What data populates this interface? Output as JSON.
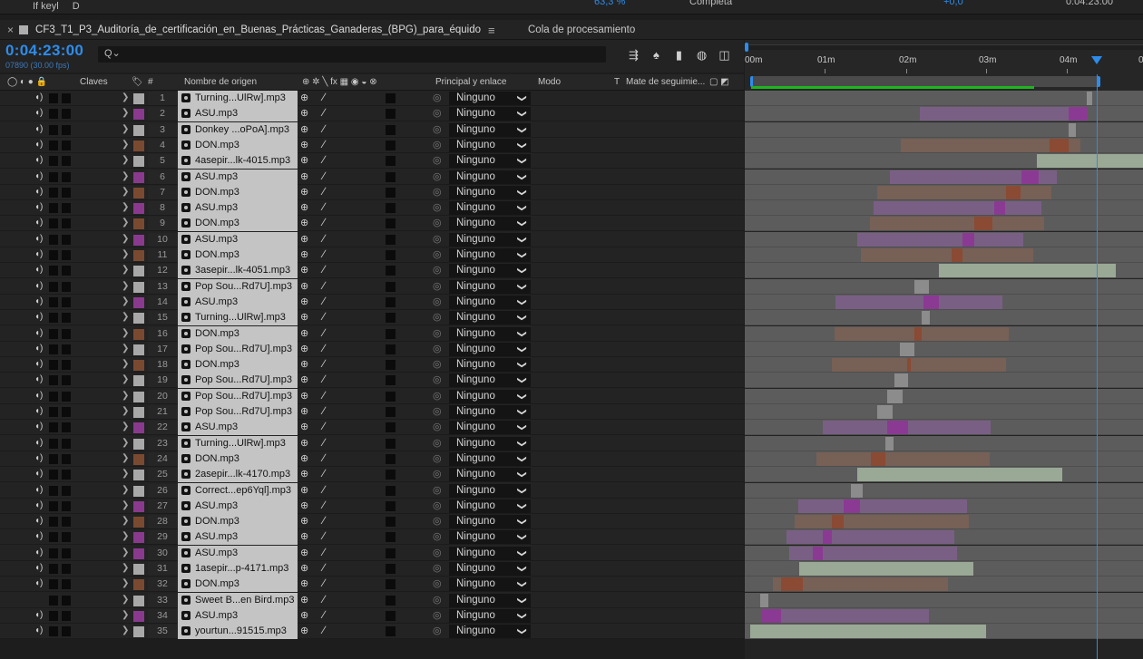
{
  "top_strip": {
    "items": [
      "If keyl",
      "D"
    ],
    "zoom": "63,3 %",
    "resolution": "Completa",
    "exposure": "+0,0",
    "timecode": "0:04:23:00"
  },
  "tabs": [
    {
      "label": "CF3_T1_P3_Auditoría_de_certificación_en_Buenas_Prácticas_Ganaderas_(BPG)_para_équido",
      "active": true
    },
    {
      "label": "Cola de procesamiento",
      "active": false
    }
  ],
  "timecode": {
    "current": "0:04:23:00",
    "frames": "07890 (30.00 fps)"
  },
  "search": {
    "placeholder": "",
    "value": "",
    "icon": "search-icon"
  },
  "columns": {
    "claves": "Claves",
    "hash": "#",
    "source": "Nombre de origen",
    "parent": "Principal y enlace",
    "mode": "Modo",
    "t": "T",
    "trackmatte": "Mate de seguimie..."
  },
  "ruler": {
    "labels": [
      "00m",
      "01m",
      "02m",
      "03m",
      "04m",
      "0"
    ]
  },
  "label_colors": {
    "gray": "#a8a8a8",
    "purple": "#8a3a8e",
    "brown": "#7a4a30"
  },
  "layers": [
    {
      "num": "1",
      "name": "Turning...UlRw].mp3",
      "color": "#a8a8a8",
      "parent": "Ninguno",
      "bar": {
        "kind": "gray",
        "start": 377,
        "end": 383,
        "kstart": 377,
        "kend": 383
      }
    },
    {
      "num": "2",
      "name": "ASU.mp3",
      "color": "#8a3a8e",
      "parent": "Ninguno",
      "bar": {
        "kind": "purple",
        "start": 193,
        "end": 378,
        "kstart": 357,
        "kend": 378
      }
    },
    {
      "num": "3",
      "name": "Donkey ...oPoA].mp3",
      "color": "#a8a8a8",
      "parent": "Ninguno",
      "bar": {
        "kind": "gray",
        "start": 357,
        "end": 365,
        "kstart": 357,
        "kend": 365
      }
    },
    {
      "num": "4",
      "name": "DON.mp3",
      "color": "#7a4a30",
      "parent": "Ninguno",
      "bar": {
        "kind": "brown",
        "start": 172,
        "end": 370,
        "kstart": 336,
        "kend": 357
      }
    },
    {
      "num": "5",
      "name": "4asepir...lk-4015.mp3",
      "color": "#a8a8a8",
      "parent": "Ninguno",
      "bar": {
        "kind": "green",
        "start": 322,
        "end": 439,
        "kstart": 322,
        "kend": 439
      }
    },
    {
      "num": "6",
      "name": "ASU.mp3",
      "color": "#8a3a8e",
      "parent": "Ninguno",
      "bar": {
        "kind": "purple",
        "start": 160,
        "end": 344,
        "kstart": 305,
        "kend": 324
      }
    },
    {
      "num": "7",
      "name": "DON.mp3",
      "color": "#7a4a30",
      "parent": "Ninguno",
      "bar": {
        "kind": "brown",
        "start": 146,
        "end": 338,
        "kstart": 288,
        "kend": 304
      }
    },
    {
      "num": "8",
      "name": "ASU.mp3",
      "color": "#8a3a8e",
      "parent": "Ninguno",
      "bar": {
        "kind": "purple",
        "start": 142,
        "end": 327,
        "kstart": 275,
        "kend": 287
      }
    },
    {
      "num": "9",
      "name": "DON.mp3",
      "color": "#7a4a30",
      "parent": "Ninguno",
      "bar": {
        "kind": "brown",
        "start": 138,
        "end": 330,
        "kstart": 253,
        "kend": 273
      }
    },
    {
      "num": "10",
      "name": "ASU.mp3",
      "color": "#8a3a8e",
      "parent": "Ninguno",
      "bar": {
        "kind": "purple",
        "start": 124,
        "end": 307,
        "kstart": 240,
        "kend": 253
      }
    },
    {
      "num": "11",
      "name": "DON.mp3",
      "color": "#7a4a30",
      "parent": "Ninguno",
      "bar": {
        "kind": "brown",
        "start": 128,
        "end": 318,
        "kstart": 228,
        "kend": 240
      }
    },
    {
      "num": "12",
      "name": "3asepir...lk-4051.mp3",
      "color": "#a8a8a8",
      "parent": "Ninguno",
      "bar": {
        "kind": "green",
        "start": 214,
        "end": 409,
        "kstart": 214,
        "kend": 409
      }
    },
    {
      "num": "13",
      "name": "Pop Sou...Rd7U].mp3",
      "color": "#a8a8a8",
      "parent": "Ninguno",
      "bar": {
        "kind": "gray",
        "start": 187,
        "end": 203,
        "kstart": 187,
        "kend": 203
      }
    },
    {
      "num": "14",
      "name": "ASU.mp3",
      "color": "#8a3a8e",
      "parent": "Ninguno",
      "bar": {
        "kind": "purple",
        "start": 100,
        "end": 284,
        "kstart": 197,
        "kend": 214
      }
    },
    {
      "num": "15",
      "name": "Turning...UlRw].mp3",
      "color": "#a8a8a8",
      "parent": "Ninguno",
      "bar": {
        "kind": "gray",
        "start": 195,
        "end": 204,
        "kstart": 195,
        "kend": 204
      }
    },
    {
      "num": "16",
      "name": "DON.mp3",
      "color": "#7a4a30",
      "parent": "Ninguno",
      "bar": {
        "kind": "brown",
        "start": 99,
        "end": 291,
        "kstart": 187,
        "kend": 195
      }
    },
    {
      "num": "17",
      "name": "Pop Sou...Rd7U].mp3",
      "color": "#a8a8a8",
      "parent": "Ninguno",
      "bar": {
        "kind": "gray",
        "start": 171,
        "end": 187,
        "kstart": 171,
        "kend": 187
      }
    },
    {
      "num": "18",
      "name": "DON.mp3",
      "color": "#7a4a30",
      "parent": "Ninguno",
      "bar": {
        "kind": "brown",
        "start": 96,
        "end": 288,
        "kstart": 179,
        "kend": 183
      }
    },
    {
      "num": "19",
      "name": "Pop Sou...Rd7U].mp3",
      "color": "#a8a8a8",
      "parent": "Ninguno",
      "bar": {
        "kind": "gray",
        "start": 165,
        "end": 180,
        "kstart": 165,
        "kend": 180
      }
    },
    {
      "num": "20",
      "name": "Pop Sou...Rd7U].mp3",
      "color": "#a8a8a8",
      "parent": "Ninguno",
      "bar": {
        "kind": "gray",
        "start": 157,
        "end": 174,
        "kstart": 157,
        "kend": 174
      }
    },
    {
      "num": "21",
      "name": "Pop Sou...Rd7U].mp3",
      "color": "#a8a8a8",
      "parent": "Ninguno",
      "bar": {
        "kind": "gray",
        "start": 146,
        "end": 163,
        "kstart": 146,
        "kend": 163
      }
    },
    {
      "num": "22",
      "name": "ASU.mp3",
      "color": "#8a3a8e",
      "parent": "Ninguno",
      "bar": {
        "kind": "purple",
        "start": 86,
        "end": 271,
        "kstart": 157,
        "kend": 180
      }
    },
    {
      "num": "23",
      "name": "Turning...UlRw].mp3",
      "color": "#a8a8a8",
      "parent": "Ninguno",
      "bar": {
        "kind": "gray",
        "start": 155,
        "end": 164,
        "kstart": 155,
        "kend": 164
      }
    },
    {
      "num": "24",
      "name": "DON.mp3",
      "color": "#7a4a30",
      "parent": "Ninguno",
      "bar": {
        "kind": "brown",
        "start": 79,
        "end": 270,
        "kstart": 139,
        "kend": 155
      }
    },
    {
      "num": "25",
      "name": "2asepir...lk-4170.mp3",
      "color": "#a8a8a8",
      "parent": "Ninguno",
      "bar": {
        "kind": "green",
        "start": 124,
        "end": 350,
        "kstart": 124,
        "kend": 350
      }
    },
    {
      "num": "26",
      "name": "Correct...ep6Yql].mp3",
      "color": "#a8a8a8",
      "parent": "Ninguno",
      "bar": {
        "kind": "gray",
        "start": 117,
        "end": 130,
        "kstart": 117,
        "kend": 130
      }
    },
    {
      "num": "27",
      "name": "ASU.mp3",
      "color": "#8a3a8e",
      "parent": "Ninguno",
      "bar": {
        "kind": "purple",
        "start": 59,
        "end": 245,
        "kstart": 109,
        "kend": 127
      }
    },
    {
      "num": "28",
      "name": "DON.mp3",
      "color": "#7a4a30",
      "parent": "Ninguno",
      "bar": {
        "kind": "brown",
        "start": 55,
        "end": 247,
        "kstart": 96,
        "kend": 109
      }
    },
    {
      "num": "29",
      "name": "ASU.mp3",
      "color": "#8a3a8e",
      "parent": "Ninguno",
      "bar": {
        "kind": "purple",
        "start": 46,
        "end": 231,
        "kstart": 86,
        "kend": 96
      }
    },
    {
      "num": "30",
      "name": "ASU.mp3",
      "color": "#8a3a8e",
      "parent": "Ninguno",
      "bar": {
        "kind": "purple",
        "start": 49,
        "end": 234,
        "kstart": 75,
        "kend": 86
      }
    },
    {
      "num": "31",
      "name": "1asepir...p-4171.mp3",
      "color": "#a8a8a8",
      "parent": "Ninguno",
      "bar": {
        "kind": "green",
        "start": 60,
        "end": 252,
        "kstart": 60,
        "kend": 252
      }
    },
    {
      "num": "32",
      "name": "DON.mp3",
      "color": "#7a4a30",
      "parent": "Ninguno",
      "bar": {
        "kind": "brown",
        "start": 31,
        "end": 224,
        "kstart": 40,
        "kend": 64
      }
    },
    {
      "num": "33",
      "name": "Sweet B...en Bird.mp3",
      "color": "#a8a8a8",
      "parent": "Ninguno",
      "bar": {
        "kind": "gray",
        "start": 17,
        "end": 26,
        "kstart": 17,
        "kend": 26
      }
    },
    {
      "num": "34",
      "name": "ASU.mp3",
      "color": "#8a3a8e",
      "parent": "Ninguno",
      "bar": {
        "kind": "purple",
        "start": 19,
        "end": 203,
        "kstart": 19,
        "kend": 40
      }
    },
    {
      "num": "35",
      "name": "yourtun...91515.mp3",
      "color": "#a8a8a8",
      "parent": "Ninguno",
      "bar": {
        "kind": "green",
        "start": 6,
        "end": 266,
        "kstart": 6,
        "kend": 266
      }
    }
  ]
}
